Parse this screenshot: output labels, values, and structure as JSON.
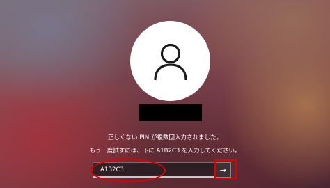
{
  "login": {
    "avatar_icon": "user-icon",
    "error_message": "正しくない PIN が複数回入力されました。",
    "instruction": "もう一度試すには、下に A1B2C3 を入力してください。",
    "challenge_input": {
      "value": "A1B2C3",
      "placeholder": ""
    },
    "submit_icon": "arrow-right-icon"
  },
  "colors": {
    "annotation": "#e00000",
    "avatar_bg": "#ffffff",
    "redaction": "#000000"
  }
}
